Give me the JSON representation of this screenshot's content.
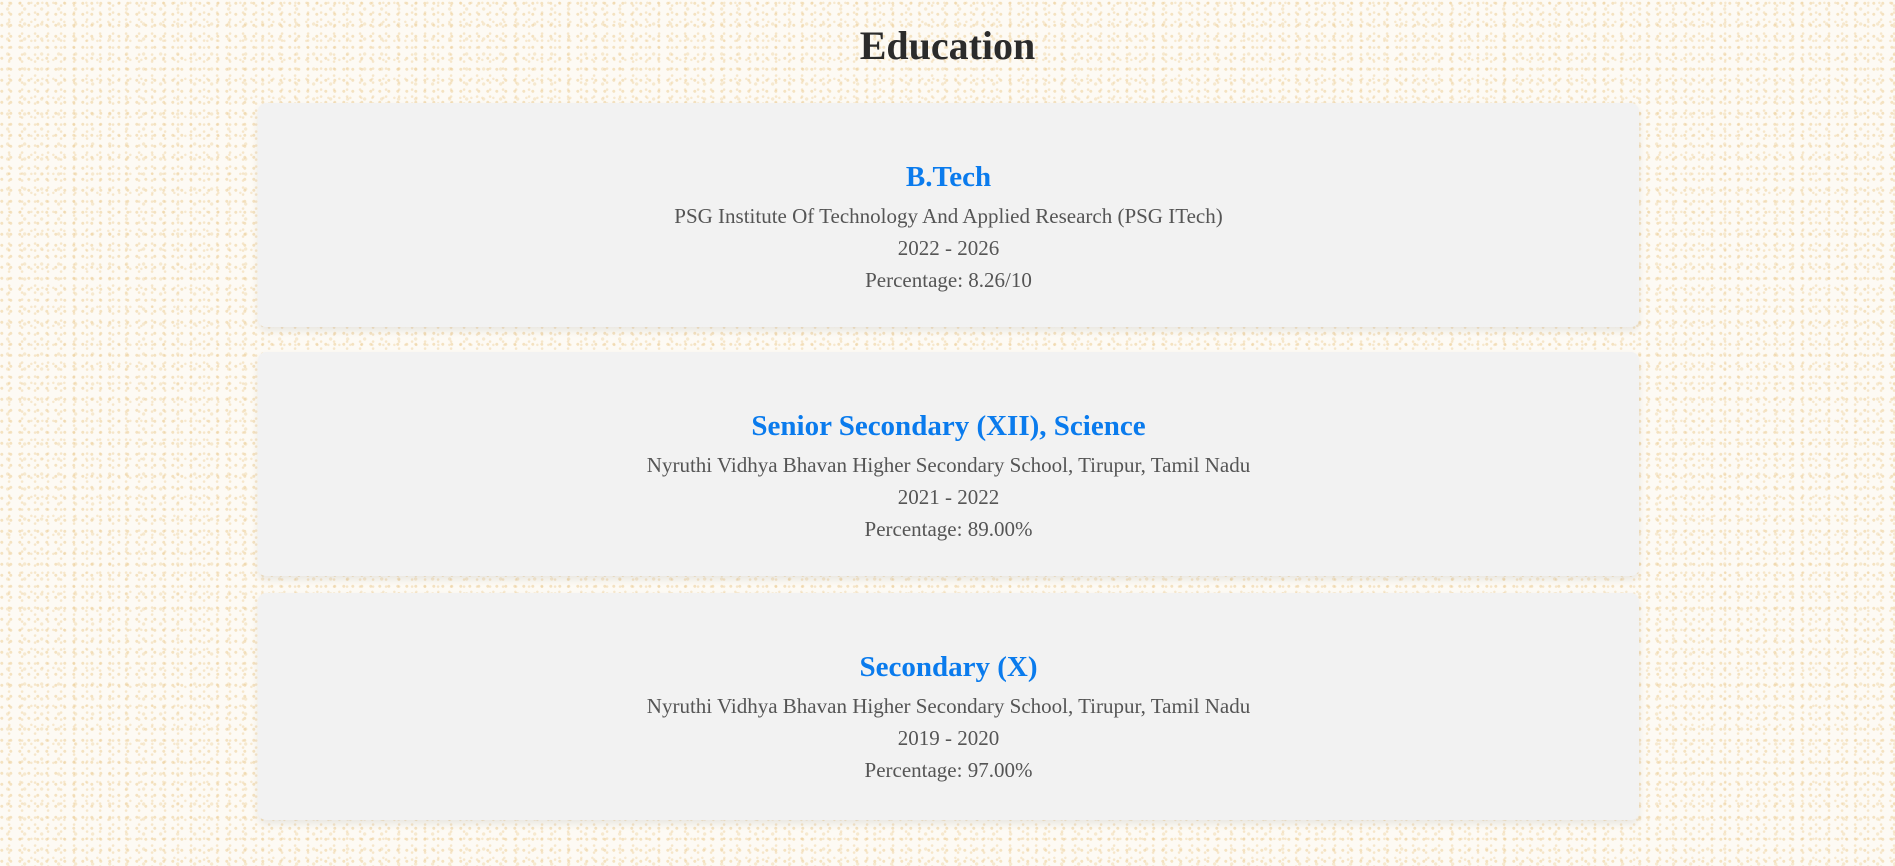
{
  "section": {
    "title": "Education"
  },
  "entries": [
    {
      "degree": "B.Tech",
      "institution": "PSG Institute Of Technology And Applied Research (PSG ITech)",
      "years": "2022 - 2026",
      "percentage": "Percentage: 8.26/10"
    },
    {
      "degree": "Senior Secondary (XII), Science",
      "institution": "Nyruthi Vidhya Bhavan Higher Secondary School, Tirupur, Tamil Nadu",
      "years": "2021 - 2022",
      "percentage": "Percentage: 89.00%"
    },
    {
      "degree": "Secondary (X)",
      "institution": "Nyruthi Vidhya Bhavan Higher Secondary School, Tirupur, Tamil Nadu",
      "years": "2019 - 2020",
      "percentage": "Percentage: 97.00%"
    }
  ],
  "colors": {
    "accent": "#0a7bed",
    "card_background": "#f2f2f2",
    "title_text": "#2b2b2b",
    "body_text": "#555555"
  }
}
